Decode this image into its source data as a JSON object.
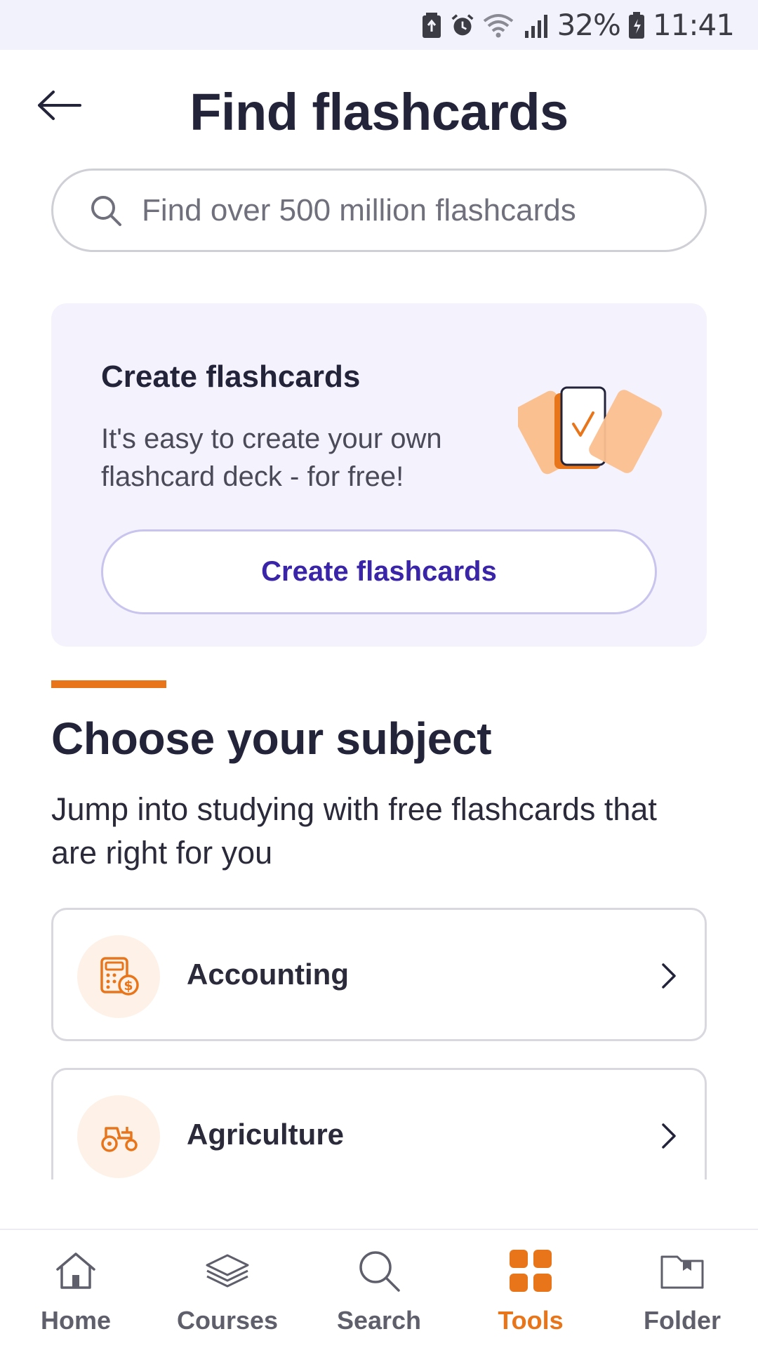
{
  "status_bar": {
    "battery_percent": "32%",
    "time": "11:41",
    "icons": [
      "battery-saver-icon",
      "alarm-icon",
      "wifi-icon",
      "signal-icon",
      "battery-charging-icon"
    ]
  },
  "header": {
    "title": "Find flashcards",
    "back_icon": "arrow-left-icon"
  },
  "search": {
    "placeholder": "Find over 500 million flashcards",
    "value": "",
    "icon": "search-icon"
  },
  "create_card": {
    "title": "Create flashcards",
    "description": "It's easy to create your own flashcard deck - for free!",
    "button_label": "Create flashcards",
    "illustration": "flashcards-phone-illustration"
  },
  "subjects_section": {
    "title": "Choose your subject",
    "description": "Jump into studying with free flashcards that are right for you",
    "items": [
      {
        "label": "Accounting",
        "icon": "calculator-coin-icon"
      },
      {
        "label": "Agriculture",
        "icon": "tractor-icon"
      }
    ]
  },
  "bottom_nav": {
    "items": [
      {
        "label": "Home",
        "icon": "home-icon",
        "active": false
      },
      {
        "label": "Courses",
        "icon": "layers-icon",
        "active": false
      },
      {
        "label": "Search",
        "icon": "search-icon",
        "active": false
      },
      {
        "label": "Tools",
        "icon": "grid-icon",
        "active": true
      },
      {
        "label": "Folder",
        "icon": "folder-icon",
        "active": false
      }
    ]
  },
  "colors": {
    "accent": "#e8751a",
    "primary_text": "#23233a",
    "brand_purple": "#3a25a8",
    "card_background": "#f3f2fd"
  }
}
